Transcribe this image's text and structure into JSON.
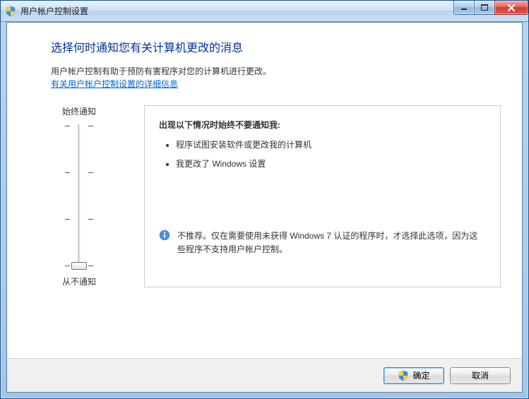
{
  "window": {
    "title": "用户帐户控制设置"
  },
  "heading": "选择何时通知您有关计算机更改的消息",
  "description": "用户帐户控制有助于预防有害程序对您的计算机进行更改。",
  "link_text": "有关用户帐户控制设置的详细信息",
  "slider": {
    "top_label": "始终通知",
    "bottom_label": "从不通知"
  },
  "info": {
    "title": "出现以下情况时始终不要通知我:",
    "bullets": [
      "程序试图安装软件或更改我的计算机",
      "我更改了 Windows 设置"
    ],
    "recommendation": "不推荐。仅在需要使用未获得 Windows 7 认证的程序时，才选择此选项，因为这些程序不支持用户帐户控制。"
  },
  "buttons": {
    "ok": "确定",
    "cancel": "取消"
  }
}
